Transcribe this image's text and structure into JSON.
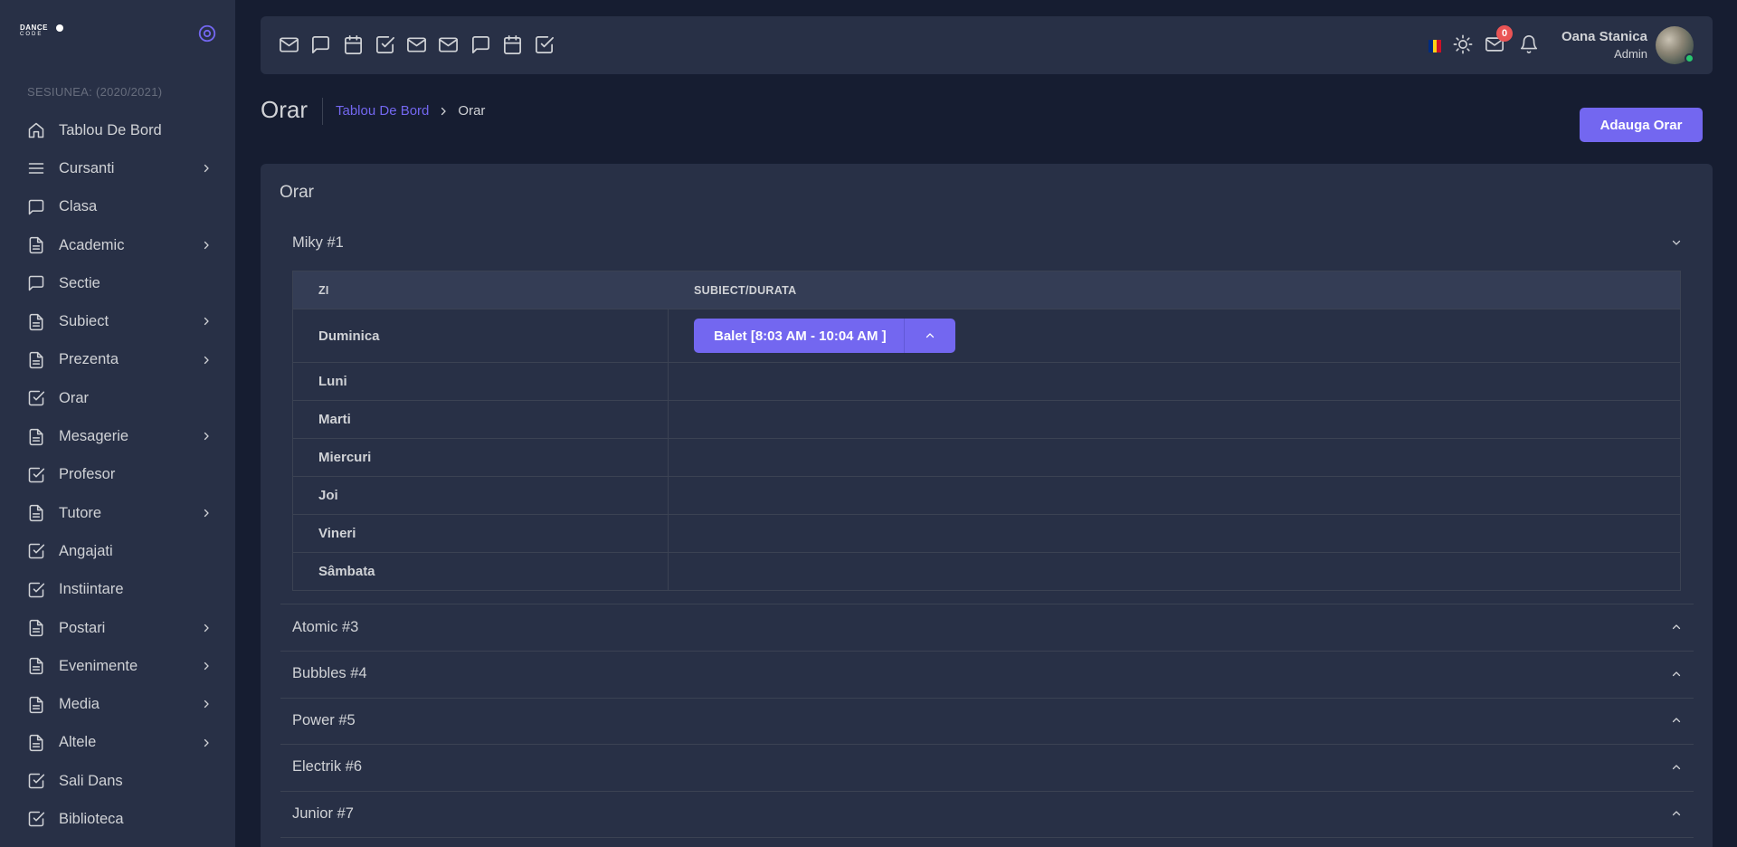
{
  "brand": {
    "line1": "DANCE",
    "line2": "CODE"
  },
  "sidebar": {
    "session": "SESIUNEA: (2020/2021)",
    "items": [
      {
        "label": "Tablou De Bord",
        "icon": "home-icon",
        "has_submenu": false
      },
      {
        "label": "Cursanti",
        "icon": "menu-icon",
        "has_submenu": true
      },
      {
        "label": "Clasa",
        "icon": "message-square-icon",
        "has_submenu": false
      },
      {
        "label": "Academic",
        "icon": "file-text-icon",
        "has_submenu": true
      },
      {
        "label": "Sectie",
        "icon": "message-square-icon",
        "has_submenu": false
      },
      {
        "label": "Subiect",
        "icon": "file-text-icon",
        "has_submenu": true
      },
      {
        "label": "Prezenta",
        "icon": "file-text-icon",
        "has_submenu": true
      },
      {
        "label": "Orar",
        "icon": "check-square-icon",
        "has_submenu": false
      },
      {
        "label": "Mesagerie",
        "icon": "file-text-icon",
        "has_submenu": true
      },
      {
        "label": "Profesor",
        "icon": "check-square-icon",
        "has_submenu": false
      },
      {
        "label": "Tutore",
        "icon": "file-text-icon",
        "has_submenu": true
      },
      {
        "label": "Angajati",
        "icon": "check-square-icon",
        "has_submenu": false
      },
      {
        "label": "Instiintare",
        "icon": "check-square-icon",
        "has_submenu": false
      },
      {
        "label": "Postari",
        "icon": "file-text-icon",
        "has_submenu": true
      },
      {
        "label": "Evenimente",
        "icon": "file-text-icon",
        "has_submenu": true
      },
      {
        "label": "Media",
        "icon": "file-text-icon",
        "has_submenu": true
      },
      {
        "label": "Altele",
        "icon": "file-text-icon",
        "has_submenu": true
      },
      {
        "label": "Sali Dans",
        "icon": "check-square-icon",
        "has_submenu": false
      },
      {
        "label": "Biblioteca",
        "icon": "check-square-icon",
        "has_submenu": false
      }
    ]
  },
  "topbar": {
    "shortcut_icons": [
      "mail-icon",
      "message-square-icon",
      "calendar-icon",
      "check-square-icon",
      "mail-icon",
      "mail-icon",
      "message-square-icon",
      "calendar-icon",
      "check-square-icon"
    ],
    "mail_badge": "0",
    "user": {
      "name": "Oana Stanica",
      "role": "Admin"
    }
  },
  "header": {
    "title": "Orar",
    "breadcrumb_link": "Tablou De Bord",
    "breadcrumb_current": "Orar",
    "add_button": "Adauga Orar"
  },
  "card": {
    "title": "Orar",
    "open_group": "Miky #1",
    "table": {
      "headers": [
        "ZI",
        "SUBIECT/DURATA"
      ],
      "rows": [
        {
          "day": "Duminica",
          "entry": "Balet [8:03 AM - 10:04 AM ]"
        },
        {
          "day": "Luni",
          "entry": ""
        },
        {
          "day": "Marti",
          "entry": ""
        },
        {
          "day": "Miercuri",
          "entry": ""
        },
        {
          "day": "Joi",
          "entry": ""
        },
        {
          "day": "Vineri",
          "entry": ""
        },
        {
          "day": "Sâmbata",
          "entry": ""
        }
      ]
    },
    "collapsed_groups": [
      "Atomic #3",
      "Bubbles #4",
      "Power #5",
      "Electrik #6",
      "Junior #7"
    ]
  },
  "colors": {
    "accent": "#7367f0",
    "background": "#161d31",
    "panel": "#283046",
    "badge": "#ea5455",
    "online": "#28c76f"
  }
}
